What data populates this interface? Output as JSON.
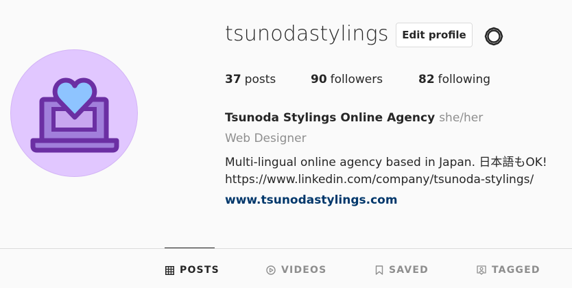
{
  "profile": {
    "username": "tsunodastylings",
    "edit_label": "Edit profile",
    "settings_icon": "gear-icon"
  },
  "stats": {
    "posts_count": "37",
    "posts_label": "posts",
    "followers_count": "90",
    "followers_label": "followers",
    "following_count": "82",
    "following_label": "following"
  },
  "bio": {
    "name": "Tsunoda Stylings Online Agency",
    "pronouns": "she/her",
    "category": "Web Designer",
    "line1": "Multi-lingual online agency based in Japan. 日本語もOK!",
    "line2": "https://www.linkedin.com/company/tsunoda-stylings/",
    "website": "www.tsunodastylings.com"
  },
  "tabs": [
    {
      "label": "POSTS",
      "icon": "grid-icon",
      "active": true
    },
    {
      "label": "VIDEOS",
      "icon": "play-icon",
      "active": false
    },
    {
      "label": "SAVED",
      "icon": "bookmark-icon",
      "active": false
    },
    {
      "label": "TAGGED",
      "icon": "tag-person-icon",
      "active": false
    }
  ],
  "colors": {
    "avatar_bg": "#e1c7ff",
    "laptop_purple": "#6b2fa3",
    "heart_blue": "#8ec4ff",
    "link": "#00376b",
    "muted": "#8e8e8e"
  }
}
